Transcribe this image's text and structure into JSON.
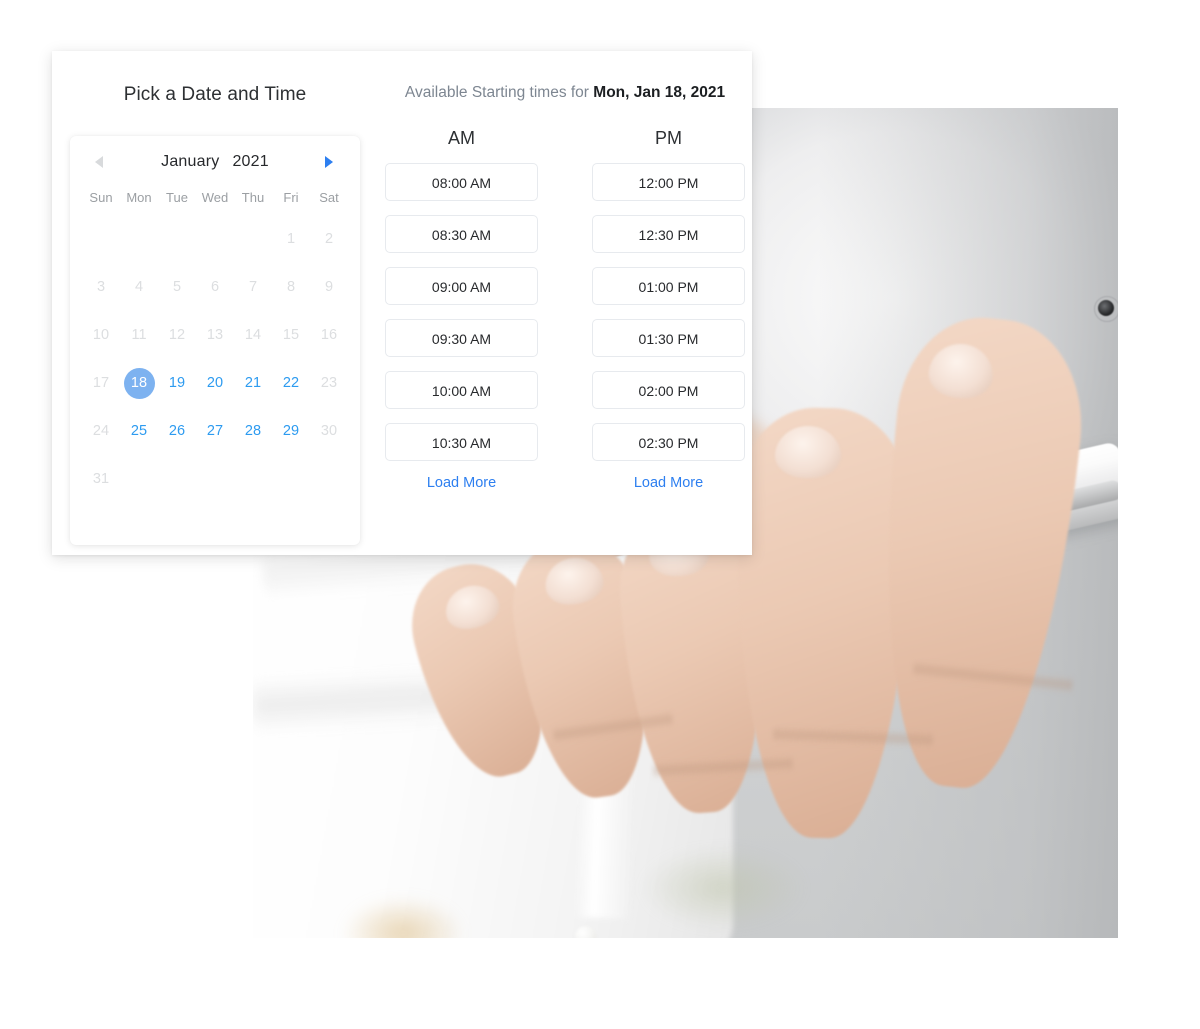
{
  "panel": {
    "left_title": "Pick a Date and Time",
    "availability": {
      "prefix": "Available Starting times for ",
      "date": "Mon, Jan 18, 2021"
    }
  },
  "calendar": {
    "month": "January",
    "year": "2021",
    "prev_icon": "chevron-left-icon",
    "next_icon": "chevron-right-icon",
    "prev_enabled": false,
    "next_enabled": true,
    "day_headers": [
      "Sun",
      "Mon",
      "Tue",
      "Wed",
      "Thu",
      "Fri",
      "Sat"
    ],
    "lead_blanks": 5,
    "days": [
      {
        "n": "1",
        "state": "disabled"
      },
      {
        "n": "2",
        "state": "disabled"
      },
      {
        "n": "3",
        "state": "disabled"
      },
      {
        "n": "4",
        "state": "disabled"
      },
      {
        "n": "5",
        "state": "disabled"
      },
      {
        "n": "6",
        "state": "disabled"
      },
      {
        "n": "7",
        "state": "disabled"
      },
      {
        "n": "8",
        "state": "disabled"
      },
      {
        "n": "9",
        "state": "disabled"
      },
      {
        "n": "10",
        "state": "disabled"
      },
      {
        "n": "11",
        "state": "disabled"
      },
      {
        "n": "12",
        "state": "disabled"
      },
      {
        "n": "13",
        "state": "disabled"
      },
      {
        "n": "14",
        "state": "disabled"
      },
      {
        "n": "15",
        "state": "disabled"
      },
      {
        "n": "16",
        "state": "disabled"
      },
      {
        "n": "17",
        "state": "disabled"
      },
      {
        "n": "18",
        "state": "selected"
      },
      {
        "n": "19",
        "state": "avail"
      },
      {
        "n": "20",
        "state": "avail"
      },
      {
        "n": "21",
        "state": "avail"
      },
      {
        "n": "22",
        "state": "avail"
      },
      {
        "n": "23",
        "state": "disabled"
      },
      {
        "n": "24",
        "state": "disabled"
      },
      {
        "n": "25",
        "state": "avail"
      },
      {
        "n": "26",
        "state": "avail"
      },
      {
        "n": "27",
        "state": "avail"
      },
      {
        "n": "28",
        "state": "avail"
      },
      {
        "n": "29",
        "state": "avail"
      },
      {
        "n": "30",
        "state": "disabled"
      },
      {
        "n": "31",
        "state": "disabled"
      }
    ],
    "selected_day": "18"
  },
  "times": {
    "columns": [
      {
        "header": "AM",
        "slots": [
          "08:00 AM",
          "08:30 AM",
          "09:00 AM",
          "09:30 AM",
          "10:00 AM",
          "10:30 AM"
        ],
        "load_more": "Load More"
      },
      {
        "header": "PM",
        "slots": [
          "12:00 PM",
          "12:30 PM",
          "01:00 PM",
          "01:30 PM",
          "02:00 PM",
          "02:30 PM"
        ],
        "load_more": "Load More"
      }
    ]
  },
  "photo": {
    "description": "Close-up of hands holding a white smartphone, person wearing a white shirt, blurred light gray background"
  },
  "colors": {
    "accent_blue": "#2d7ff0",
    "available_day": "#2d9bf0",
    "selected_day_bg": "#7db2f0",
    "disabled_text": "#dcdee0",
    "muted_text": "#7d8691",
    "body_text": "#27292c",
    "slot_border": "#e7eaee",
    "panel_bg": "#ffffff"
  }
}
